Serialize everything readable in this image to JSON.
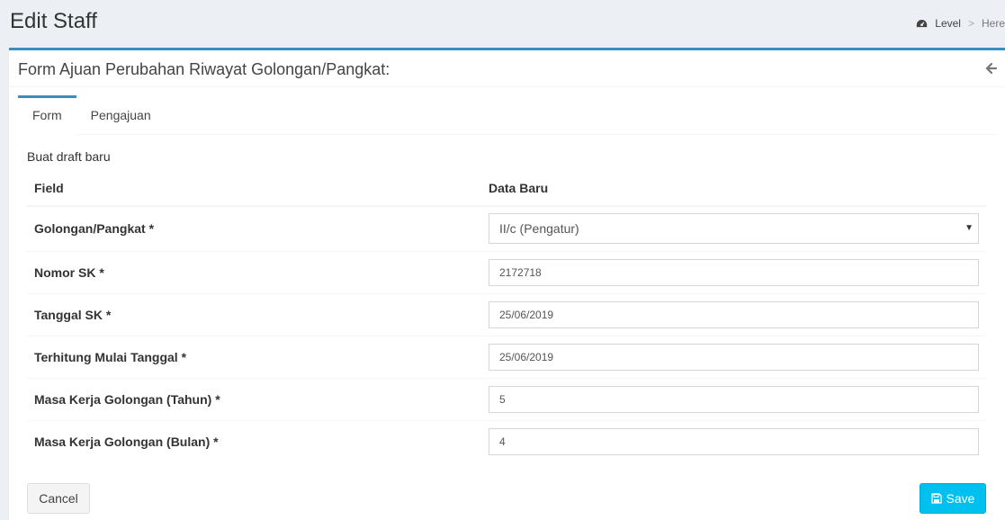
{
  "header": {
    "title": "Edit Staff",
    "breadcrumb": {
      "level_label": "Level",
      "separator": ">",
      "current": "Here"
    }
  },
  "box": {
    "title": "Form Ajuan Perubahan Riwayat Golongan/Pangkat:"
  },
  "tabs": [
    {
      "label": "Form",
      "active": true
    },
    {
      "label": "Pengajuan",
      "active": false
    }
  ],
  "form": {
    "draft_label": "Buat draft baru",
    "columns": {
      "field": "Field",
      "new_data": "Data Baru"
    },
    "rows": [
      {
        "label": "Golongan/Pangkat *",
        "value": "II/c (Pengatur)"
      },
      {
        "label": "Nomor SK *",
        "value": "2172718"
      },
      {
        "label": "Tanggal SK *",
        "value": "25/06/2019"
      },
      {
        "label": "Terhitung Mulai Tanggal *",
        "value": "25/06/2019"
      },
      {
        "label": "Masa Kerja Golongan (Tahun) *",
        "value": "5"
      },
      {
        "label": "Masa Kerja Golongan (Bulan) *",
        "value": "4"
      }
    ],
    "cancel_label": "Cancel",
    "save_label": "Save"
  },
  "icons": {
    "dashboard": "dashboard-icon",
    "back": "arrow-left-icon",
    "save": "floppy-disk-icon",
    "caret": "caret-down-icon"
  },
  "colors": {
    "accent": "#3c8dbc",
    "save_button": "#00c0ef",
    "background": "#ecf0f5"
  }
}
